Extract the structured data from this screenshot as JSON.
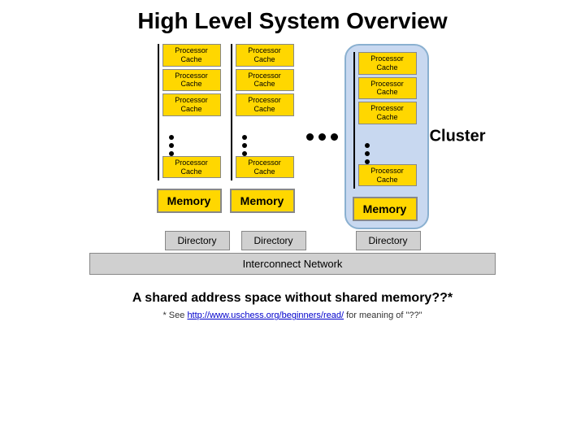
{
  "title": "High Level System Overview",
  "cluster_label": "Cluster",
  "proc_cache_label": "Processor\nCache",
  "memory_label": "Memory",
  "directory_label": "Directory",
  "interconnect_label": "Interconnect Network",
  "subtitle": "A shared address space without shared memory??*",
  "footnote_prefix": "* See ",
  "footnote_link_text": "http://www.uschess.org/beginners/read/",
  "footnote_suffix": " for meaning of \"??\"",
  "colors": {
    "proc_cache_bg": "#ffd700",
    "memory_bg": "#ffd700",
    "directory_bg": "#cccccc",
    "cluster_bg": "#c8d8f0",
    "interconnect_bg": "#cccccc"
  }
}
